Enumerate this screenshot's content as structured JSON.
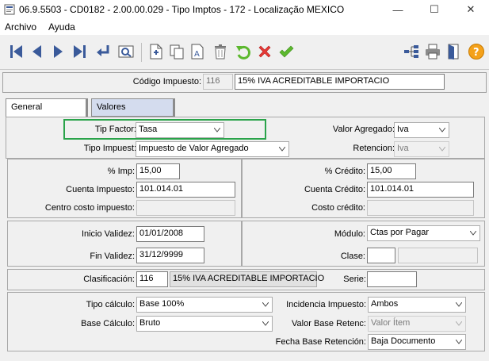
{
  "window": {
    "title": "06.9.5503 - CD0182 - 2.00.00.029 - Tipo Imptos - 172 - Localização MEXICO",
    "minimize": "—",
    "maximize": "☐",
    "close": "✕"
  },
  "menu": {
    "archivo": "Archivo",
    "ayuda": "Ayuda"
  },
  "colors": {
    "accent_green": "#2aa34a",
    "delete_red": "#e53935",
    "confirm_green": "#5cb82e",
    "nav_blue": "#3a5a9a",
    "help_orange": "#f4a11a"
  },
  "header": {
    "codigo_label": "Código Impuesto:",
    "codigo_value": "116",
    "descripcion_value": "15% IVA ACREDITABLE IMPORTACIO"
  },
  "tabs": {
    "general": "General",
    "valores": "Valores"
  },
  "section1": {
    "tip_factor_label": "Tip Factor:",
    "tip_factor_value": "Tasa",
    "tipo_impuest_label": "Tipo Impuest:",
    "tipo_impuest_value": "Impuesto de Valor Agregado",
    "valor_agregado_label": "Valor Agregado:",
    "valor_agregado_value": "Iva",
    "retencion_label": "Retencion:",
    "retencion_value": "Iva"
  },
  "section2": {
    "pct_imp_label": "% Imp:",
    "pct_imp_value": "15,00",
    "cuenta_impuesto_label": "Cuenta Impuesto:",
    "cuenta_impuesto_value": "101.014.01",
    "centro_costo_label": "Centro costo impuesto:",
    "centro_costo_value": "",
    "pct_credito_label": "% Crédito:",
    "pct_credito_value": "15,00",
    "cuenta_credito_label": "Cuenta Crédito:",
    "cuenta_credito_value": "101.014.01",
    "costo_credito_label": "Costo crédito:",
    "costo_credito_value": ""
  },
  "section3": {
    "inicio_validez_label": "Inicio Validez:",
    "inicio_validez_value": "01/01/2008",
    "fin_validez_label": "Fin Validez:",
    "fin_validez_value": "31/12/9999",
    "modulo_label": "Módulo:",
    "modulo_value": "Ctas por Pagar",
    "clase_label": "Clase:",
    "clase_value": ""
  },
  "section4": {
    "clasificacion_label": "Clasificación:",
    "clasificacion_code": "116",
    "clasificacion_desc": "15% IVA ACREDITABLE IMPORTACIO",
    "serie_label": "Serie:",
    "serie_value": ""
  },
  "section5": {
    "tipo_calculo_label": "Tipo cálculo:",
    "tipo_calculo_value": "Base 100%",
    "base_calculo_label": "Base Cálculo:",
    "base_calculo_value": "Bruto",
    "incidencia_label": "Incidencia Impuesto:",
    "incidencia_value": "Ambos",
    "valor_base_retenc_label": "Valor Base Retenc:",
    "valor_base_retenc_value": "Valor Ítem",
    "fecha_base_retencion_label": "Fecha Base Retención:",
    "fecha_base_retencion_value": "Baja Documento"
  }
}
